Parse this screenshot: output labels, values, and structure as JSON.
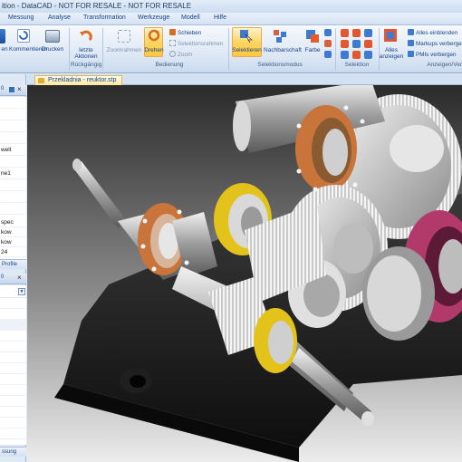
{
  "app": {
    "title": "ition - DataCAD - NOT FOR RESALE - NOT FOR RESALE"
  },
  "menu": {
    "items": [
      "Messung",
      "Analyse",
      "Transformation",
      "Werkzeuge",
      "Modell",
      "Hilfe"
    ]
  },
  "ribbon": {
    "buttons": {
      "open_label": "en",
      "comment_label": "Kommentieren",
      "print_label": "Drucken",
      "undo_label1": "letzte",
      "undo_label2": "Aktionen",
      "zoomframe_label": "Zoomrahmen",
      "rotate_label": "Drehen",
      "select_label": "Selektieren",
      "neighbor_label": "Nachbarschaft",
      "color_label": "Farbe",
      "show_all_label1": "Alles",
      "show_all_label2": "anzeigen"
    },
    "edit_items": [
      "Schieben",
      "Selektionsrahmen",
      "Zoom"
    ],
    "view_items": [
      "Alles einblenden",
      "Markups verberge",
      "PMIs verbergen"
    ],
    "groups": {
      "undo": "Rückgängig",
      "edit": "Bedienung",
      "select_mode": "Selektionsmodus",
      "selection": "Selektion",
      "display": "Anzeigen/Ver"
    }
  },
  "left_panel": {
    "upper_header_controls": "0",
    "upper_rows": [
      "",
      "",
      "",
      "",
      "welt",
      "",
      "ne1",
      "",
      "",
      "",
      "",
      "",
      "",
      "spec",
      "kow",
      "kow",
      "24"
    ],
    "tab_label": "Profile",
    "lower_header_controls": "0",
    "lower_rows": [
      "",
      "",
      "",
      "",
      "",
      "",
      "",
      "",
      "",
      "",
      "",
      "",
      "",
      "",
      "",
      "",
      "",
      "",
      "",
      "",
      "",
      "",
      "",
      ""
    ],
    "bottom_tab_label": "ssung"
  },
  "document": {
    "tab_label": "Przekladnia - reuktor.stp"
  },
  "colors": {
    "viewport_background_top": "#2a2a2a",
    "viewport_background_bottom": "#ececec",
    "housing": "#1a1a1a",
    "gear_silver": "#c8c8c8",
    "ring_copper": "#c8743a",
    "ring_yellow": "#e3c21c",
    "ring_magenta": "#b23a6a",
    "ribbon_highlight": "#ffd463"
  }
}
